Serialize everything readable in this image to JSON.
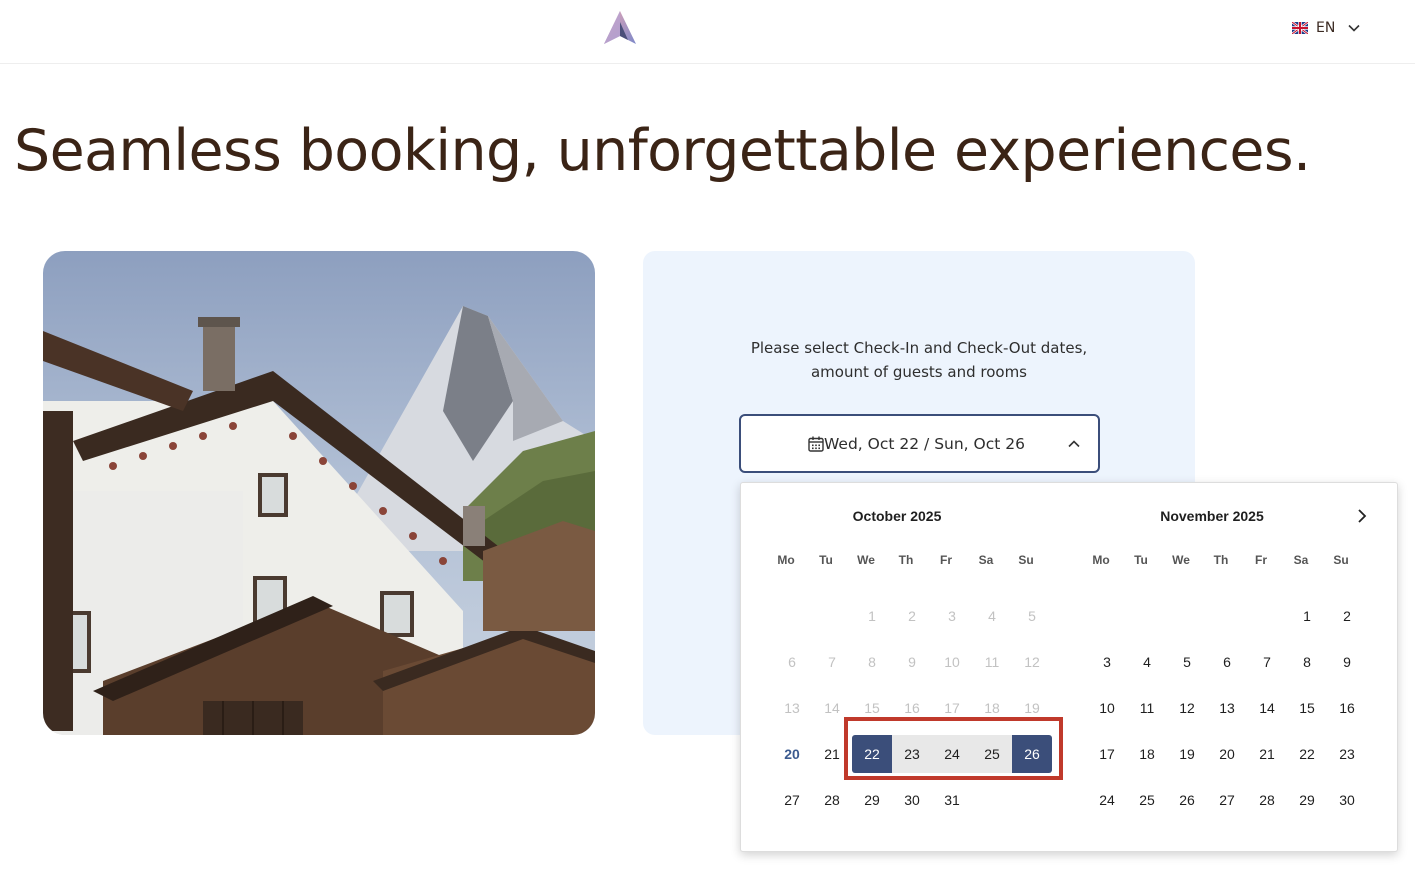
{
  "header": {
    "logo_name": "brand-logo",
    "language": {
      "label": "EN",
      "flag": "uk-flag-icon"
    }
  },
  "hero": {
    "title": "Seamless booking, unforgettable experiences."
  },
  "booking": {
    "prompt_line1": "Please select Check-In and Check-Out dates,",
    "prompt_line2": "amount of guests and rooms",
    "date_range": "Wed, Oct 22 / Sun, Oct 26"
  },
  "calendar": {
    "weekdays": [
      "Mo",
      "Tu",
      "We",
      "Th",
      "Fr",
      "Sa",
      "Su"
    ],
    "months": [
      {
        "title": "October 2025",
        "offset": 2,
        "days": 31,
        "disabled_through": 19,
        "today": 20,
        "range_start": 22,
        "range_end": 26
      },
      {
        "title": "November 2025",
        "offset": 5,
        "days": 30,
        "disabled_through": 0,
        "today": null,
        "range_start": null,
        "range_end": null
      }
    ]
  },
  "colors": {
    "accent": "#3b4e7a",
    "range": "#e8e8e8",
    "panel": "#edf4fd",
    "heading": "#3b2416",
    "annotation": "#c0392b"
  }
}
